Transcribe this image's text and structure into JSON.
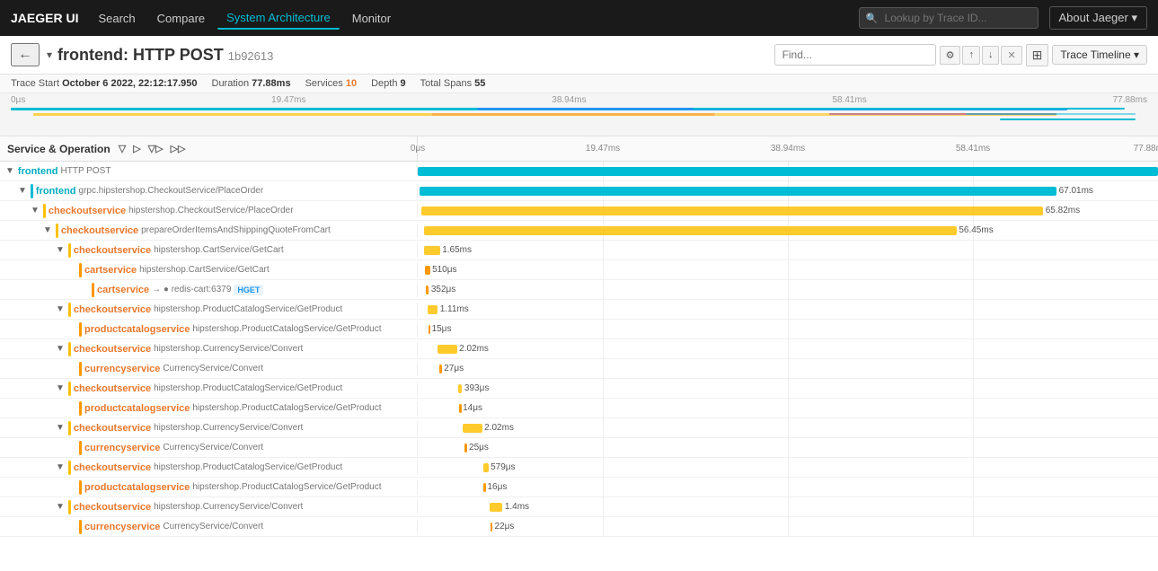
{
  "nav": {
    "brand": "JAEGER UI",
    "items": [
      {
        "label": "Search",
        "active": false
      },
      {
        "label": "Compare",
        "active": false
      },
      {
        "label": "System Architecture",
        "active": true
      },
      {
        "label": "Monitor",
        "active": false
      }
    ],
    "search_placeholder": "Lookup by Trace ID...",
    "about_label": "About Jaeger ▾"
  },
  "trace_header": {
    "back_label": "←",
    "collapse_icon": "▾",
    "service_name": "frontend:",
    "operation": "HTTP POST",
    "trace_id": "1b92613",
    "find_placeholder": "Find...",
    "find_prev": "↑",
    "find_next": "↓",
    "find_close": "✕",
    "grid_icon": "⊞",
    "timeline_btn": "Trace Timeline ▾"
  },
  "trace_meta": {
    "trace_start_label": "Trace Start",
    "trace_start_value": "October 6 2022, 22:12:17.950",
    "duration_label": "Duration",
    "duration_value": "77.88ms",
    "services_label": "Services",
    "services_value": "10",
    "depth_label": "Depth",
    "depth_value": "9",
    "total_spans_label": "Total Spans",
    "total_spans_value": "55"
  },
  "timeline_ticks": [
    "0μs",
    "19.47ms",
    "38.94ms",
    "58.41ms",
    "77.88ms"
  ],
  "col_header": {
    "label": "Service & Operation",
    "arrows": [
      "▽",
      "▷",
      "▽▷",
      "▷▷"
    ]
  },
  "spans": [
    {
      "id": "s1",
      "indent": 0,
      "toggle": "▼",
      "service": "frontend",
      "service_class": "svc-frontend",
      "operation": "HTTP POST",
      "tag": "HTTP POST",
      "tag_class": "post",
      "bar_left_pct": 0,
      "bar_width_pct": 100,
      "bar_class": "color-frontend",
      "duration": "",
      "show_connector": false,
      "depth": 0
    },
    {
      "id": "s2",
      "indent": 1,
      "toggle": "▼",
      "service": "frontend",
      "service_class": "svc-frontend",
      "operation": "grpc.hipstershop.CheckoutService/PlaceOrder",
      "tag": "",
      "bar_left_pct": 0.3,
      "bar_width_pct": 86,
      "bar_class": "color-frontend",
      "duration": "67.01ms",
      "show_connector": true,
      "depth": 1
    },
    {
      "id": "s3",
      "indent": 2,
      "toggle": "▼",
      "service": "checkoutservice",
      "service_class": "svc-checkout",
      "operation": "hipstershop.CheckoutService/PlaceOrder",
      "tag": "",
      "bar_left_pct": 0.5,
      "bar_width_pct": 84,
      "bar_class": "color-checkout",
      "duration": "65.82ms",
      "show_connector": true,
      "depth": 2
    },
    {
      "id": "s4",
      "indent": 3,
      "toggle": "▼",
      "service": "checkoutservice",
      "service_class": "svc-checkout",
      "operation": "prepareOrderItemsAndShippingQuoteFromCart",
      "tag": "",
      "bar_left_pct": 0.8,
      "bar_width_pct": 72,
      "bar_class": "color-checkout",
      "duration": "56.45ms",
      "show_connector": true,
      "depth": 3
    },
    {
      "id": "s5",
      "indent": 4,
      "toggle": "▼",
      "service": "checkoutservice",
      "service_class": "svc-checkout",
      "operation": "hipstershop.CartService/GetCart",
      "tag": "",
      "bar_left_pct": 0.9,
      "bar_width_pct": 2.1,
      "bar_class": "color-checkout",
      "duration": "1.65ms",
      "show_connector": true,
      "depth": 4
    },
    {
      "id": "s6",
      "indent": 5,
      "toggle": "",
      "service": "cartservice",
      "service_class": "svc-cart",
      "operation": "hipstershop.CartService/GetCart",
      "tag": "",
      "bar_left_pct": 1.0,
      "bar_width_pct": 0.65,
      "bar_class": "color-cart",
      "duration": "510μs",
      "show_connector": true,
      "depth": 5
    },
    {
      "id": "s7",
      "indent": 6,
      "toggle": "",
      "service": "cartservice",
      "service_class": "svc-cart",
      "operation": "→ ● redis-cart:6379",
      "tag": "HGET",
      "tag_class": "hget",
      "bar_left_pct": 1.05,
      "bar_width_pct": 0.45,
      "bar_class": "color-redis",
      "duration": "352μs",
      "show_connector": true,
      "depth": 6
    },
    {
      "id": "s8",
      "indent": 4,
      "toggle": "▼",
      "service": "checkoutservice",
      "service_class": "svc-checkout",
      "operation": "hipstershop.ProductCatalogService/GetProduct",
      "tag": "",
      "bar_left_pct": 1.3,
      "bar_width_pct": 1.4,
      "bar_class": "color-checkout",
      "duration": "1.11ms",
      "show_connector": true,
      "depth": 4
    },
    {
      "id": "s9",
      "indent": 5,
      "toggle": "",
      "service": "productcatalogservice",
      "service_class": "svc-catalog",
      "operation": "hipstershop.ProductCatalogService/GetProduct",
      "tag": "",
      "bar_left_pct": 1.4,
      "bar_width_pct": 0.19,
      "bar_class": "color-catalog",
      "duration": "15μs",
      "show_connector": true,
      "depth": 5
    },
    {
      "id": "s10",
      "indent": 4,
      "toggle": "▼",
      "service": "checkoutservice",
      "service_class": "svc-checkout",
      "operation": "hipstershop.CurrencyService/Convert",
      "tag": "",
      "bar_left_pct": 2.7,
      "bar_width_pct": 2.6,
      "bar_class": "color-checkout",
      "duration": "2.02ms",
      "show_connector": true,
      "depth": 4
    },
    {
      "id": "s11",
      "indent": 5,
      "toggle": "",
      "service": "currencyservice",
      "service_class": "svc-currency",
      "operation": "CurrencyService/Convert",
      "tag": "",
      "bar_left_pct": 2.9,
      "bar_width_pct": 0.35,
      "bar_class": "color-currency",
      "duration": "27μs",
      "show_connector": true,
      "depth": 5
    },
    {
      "id": "s12",
      "indent": 4,
      "toggle": "▼",
      "service": "checkoutservice",
      "service_class": "svc-checkout",
      "operation": "hipstershop.ProductCatalogService/GetProduct",
      "tag": "",
      "bar_left_pct": 5.5,
      "bar_width_pct": 0.5,
      "bar_class": "color-checkout",
      "duration": "393μs",
      "show_connector": true,
      "depth": 4
    },
    {
      "id": "s13",
      "indent": 5,
      "toggle": "",
      "service": "productcatalogservice",
      "service_class": "svc-catalog",
      "operation": "hipstershop.ProductCatalogService/GetProduct",
      "tag": "",
      "bar_left_pct": 5.6,
      "bar_width_pct": 0.18,
      "bar_class": "color-catalog",
      "duration": "14μs",
      "show_connector": true,
      "depth": 5
    },
    {
      "id": "s14",
      "indent": 4,
      "toggle": "▼",
      "service": "checkoutservice",
      "service_class": "svc-checkout",
      "operation": "hipstershop.CurrencyService/Convert",
      "tag": "",
      "bar_left_pct": 6.1,
      "bar_width_pct": 2.6,
      "bar_class": "color-checkout",
      "duration": "2.02ms",
      "show_connector": true,
      "depth": 4
    },
    {
      "id": "s15",
      "indent": 5,
      "toggle": "",
      "service": "currencyservice",
      "service_class": "svc-currency",
      "operation": "CurrencyService/Convert",
      "tag": "",
      "bar_left_pct": 6.3,
      "bar_width_pct": 0.32,
      "bar_class": "color-currency",
      "duration": "25μs",
      "show_connector": true,
      "depth": 5
    },
    {
      "id": "s16",
      "indent": 4,
      "toggle": "▼",
      "service": "checkoutservice",
      "service_class": "svc-checkout",
      "operation": "hipstershop.ProductCatalogService/GetProduct",
      "tag": "",
      "bar_left_pct": 8.8,
      "bar_width_pct": 0.74,
      "bar_class": "color-checkout",
      "duration": "579μs",
      "show_connector": true,
      "depth": 4
    },
    {
      "id": "s17",
      "indent": 5,
      "toggle": "",
      "service": "productcatalogservice",
      "service_class": "svc-catalog",
      "operation": "hipstershop.ProductCatalogService/GetProduct",
      "tag": "",
      "bar_left_pct": 8.9,
      "bar_width_pct": 0.2,
      "bar_class": "color-catalog",
      "duration": "16μs",
      "show_connector": true,
      "depth": 5
    },
    {
      "id": "s18",
      "indent": 4,
      "toggle": "▼",
      "service": "checkoutservice",
      "service_class": "svc-checkout",
      "operation": "hipstershop.CurrencyService/Convert",
      "tag": "",
      "bar_left_pct": 9.65,
      "bar_width_pct": 1.8,
      "bar_class": "color-checkout",
      "duration": "1.4ms",
      "show_connector": true,
      "depth": 4
    },
    {
      "id": "s19",
      "indent": 5,
      "toggle": "",
      "service": "currencyservice",
      "service_class": "svc-currency",
      "operation": "CurrencyService/Convert",
      "tag": "",
      "bar_left_pct": 9.8,
      "bar_width_pct": 0.28,
      "bar_class": "color-currency",
      "duration": "22μs",
      "show_connector": true,
      "depth": 5
    }
  ]
}
